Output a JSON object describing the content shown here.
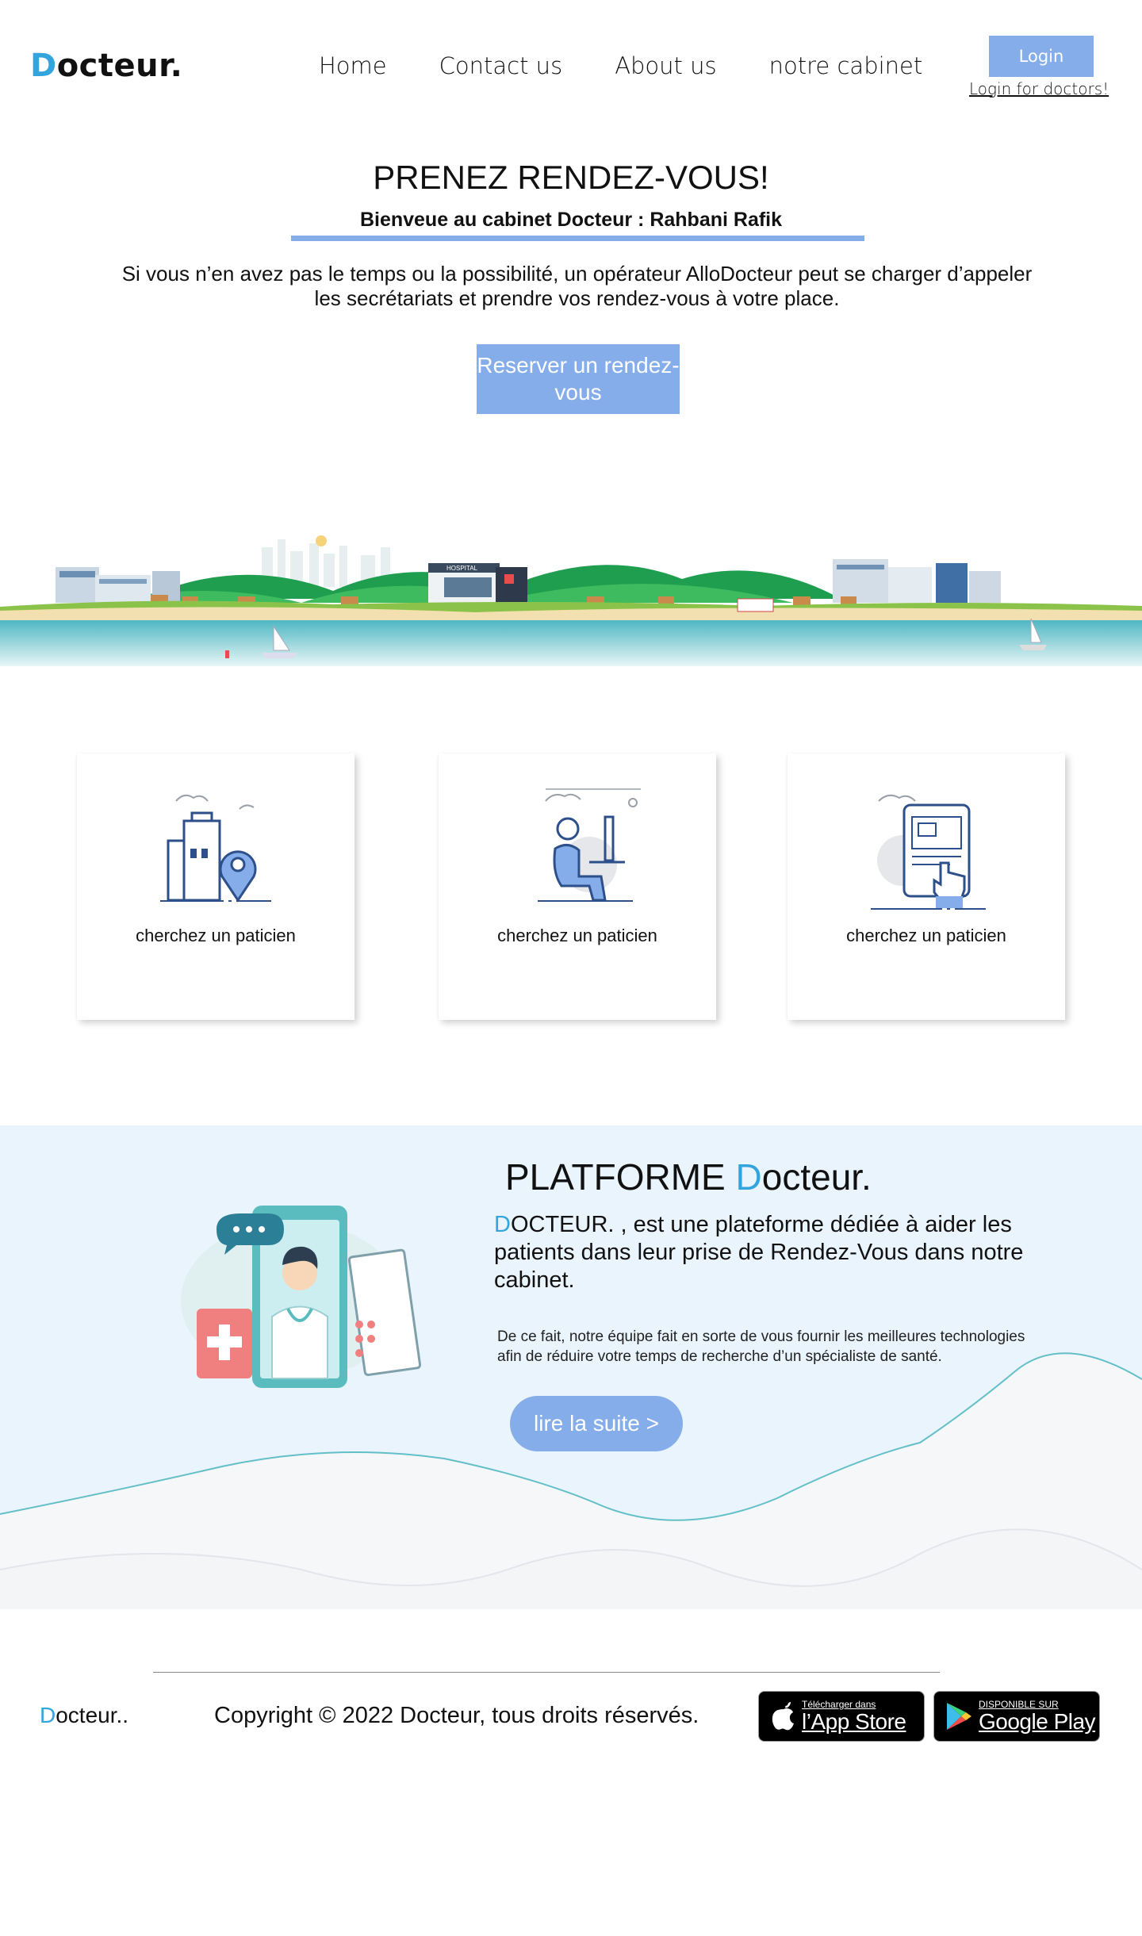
{
  "header": {
    "logo_first": "D",
    "logo_rest": "octeur.",
    "nav": [
      "Home",
      "Contact us",
      "About us",
      "notre cabinet"
    ],
    "login_label": "Login",
    "login_doctors": "Login for doctors!"
  },
  "hero": {
    "title": "PRENEZ RENDEZ-VOUS!",
    "subtitle": "Bienveue au cabinet Docteur : Rahbani Rafik",
    "text": "Si vous n’en avez pas le temps ou la possibilité, un opérateur AlloDocteur peut se charger d’appeler les secrétariats et prendre vos rendez-vous à votre place.",
    "cta": "Reserver un rendez-vous",
    "landscape_sign": "HOSPITAL"
  },
  "cards": [
    {
      "label": "cherchez un paticien",
      "icon": "building-location-icon"
    },
    {
      "label": "cherchez un paticien",
      "icon": "person-computer-icon"
    },
    {
      "label": "cherchez un paticien",
      "icon": "tablet-touch-icon"
    }
  ],
  "platform": {
    "title_prefix": "PLATFORME ",
    "title_d": "D",
    "title_rest": "octeur.",
    "main_d": "D",
    "main_rest": "OCTEUR. , est une plateforme dédiée à aider les patients dans leur prise de Rendez-Vous dans notre cabinet.",
    "small": "De ce fait, notre équipe fait en sorte de vous fournir les meilleures technologies afin de réduire votre temps de recherche d’un spécialiste de santé.",
    "read_more": "lire la suite >"
  },
  "footer": {
    "logo_d": "D",
    "logo_rest": "octeur..",
    "copyright": "Copyright © 2022 Docteur, tous droits réservés.",
    "appstore_small": "Télécharger dans",
    "appstore_big": "l’App Store",
    "gplay_small": "DISPONIBLE SUR",
    "gplay_big": "Google Play"
  },
  "colors": {
    "accent": "#84adea",
    "brand_blue": "#33a4dc",
    "platform_bg": "#eaf4fd"
  }
}
